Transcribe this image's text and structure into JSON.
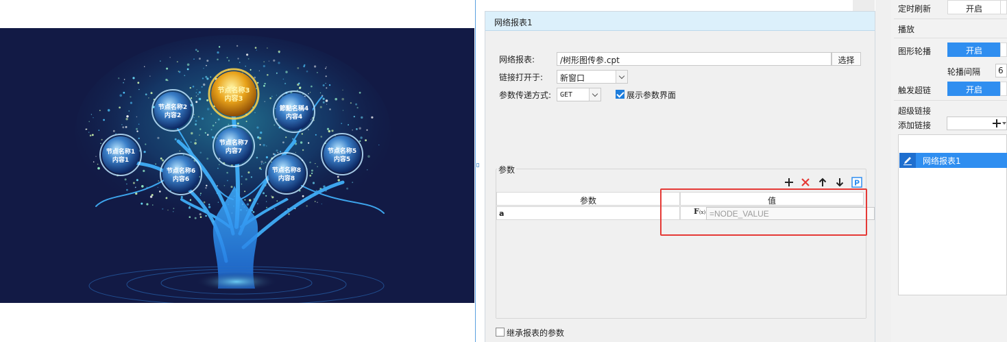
{
  "preview": {
    "nodes": [
      {
        "id": 1,
        "name": "节点名称1",
        "content": "内容1"
      },
      {
        "id": 2,
        "name": "节点名称2",
        "content": "内容2"
      },
      {
        "id": 3,
        "name": "节点名称3",
        "content": "内容3",
        "highlighted": true
      },
      {
        "id": 4,
        "name": "節點名稱4",
        "content": "内容4"
      },
      {
        "id": 5,
        "name": "节点名称5",
        "content": "内容5"
      },
      {
        "id": 6,
        "name": "节点名称6",
        "content": "内容6"
      },
      {
        "id": 7,
        "name": "节点名称7",
        "content": "内容7"
      },
      {
        "id": 8,
        "name": "节点名称8",
        "content": "内容8"
      }
    ]
  },
  "dialog": {
    "title": "网络报表1",
    "report_label": "网络报表:",
    "report_value": "/树形图传参.cpt",
    "select_button": "选择",
    "open_in_label": "链接打开于:",
    "open_in_value": "新窗口",
    "method_label": "参数传递方式:",
    "method_value": "GET",
    "show_params_label": "展示参数界面",
    "show_params_checked": true,
    "params_group_label": "参数",
    "params_table": {
      "headers": [
        "参数",
        "值"
      ],
      "rows": [
        {
          "name": "a",
          "value_placeholder": "=NODE_VALUE"
        }
      ]
    },
    "fx_label": "F",
    "fx_sub": "(x)",
    "inherit_label": "继承报表的参数",
    "inherit_checked": false
  },
  "right_panel": {
    "timed_refresh_label": "定时刷新",
    "timed_refresh_value": "开启",
    "play_section": "播放",
    "carousel_label": "图形轮播",
    "carousel_value": "开启",
    "interval_label": "轮播间隔",
    "interval_value": "6",
    "trigger_link_label": "触发超链",
    "trigger_link_value": "开启",
    "hyperlink_section": "超级链接",
    "add_link_label": "添加链接",
    "links": [
      "网络报表1"
    ]
  },
  "colors": {
    "accent": "#2f8ef0",
    "highlight_box": "#e53935",
    "dialog_title_bg": "#dcf0fb",
    "preview_bg": "#121a45"
  }
}
